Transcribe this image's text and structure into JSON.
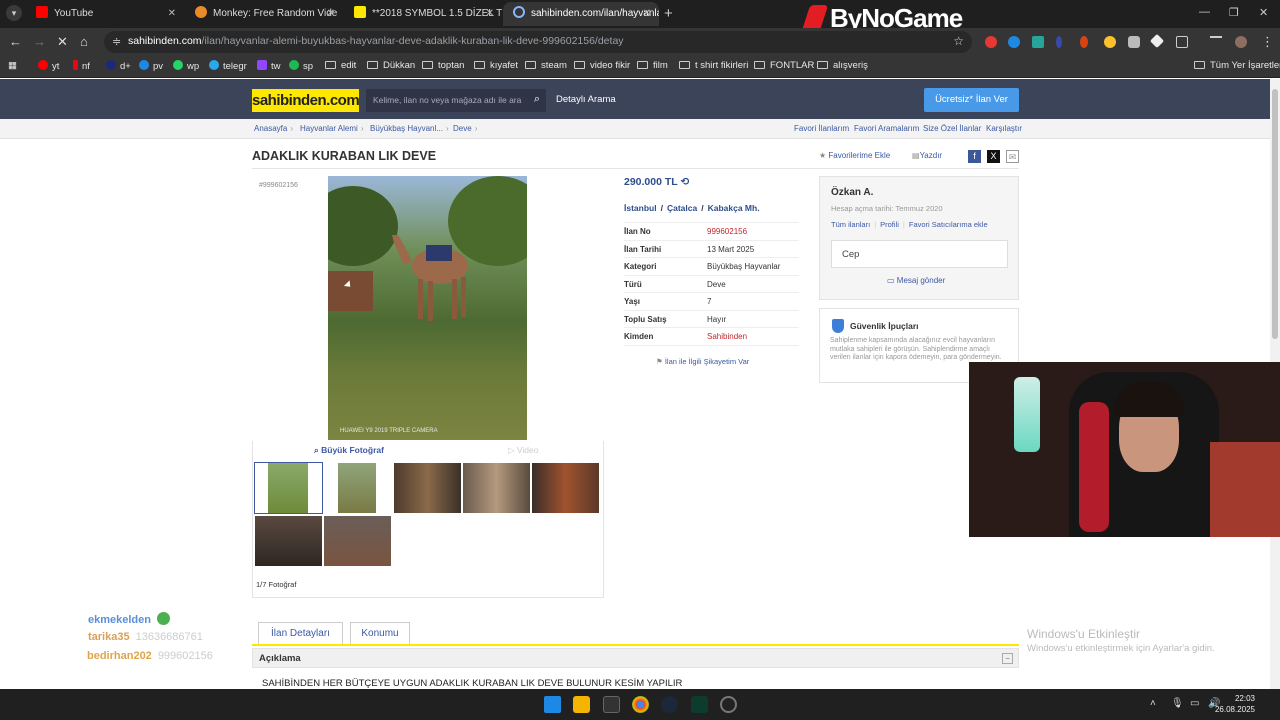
{
  "browser": {
    "tabs": [
      {
        "title": "YouTube",
        "color": "#ff0000"
      },
      {
        "title": "Monkey: Free Random Vide",
        "color": "#e98b2a"
      },
      {
        "title": "**2018 SYMBOL 1.5 DİZEL TRA",
        "color": "#ffe800"
      },
      {
        "title": "sahibinden.com/ilan/hayvanlar",
        "color": "#8ab4f8"
      }
    ],
    "new_tab": "+",
    "overlay_logo": "ByNoGame",
    "url_host": "sahibinden.com",
    "url_path": "/ilan/hayvanlar-alemi-buyukbas-hayvanlar-deve-adaklik-kuraban-lik-deve-999602156/detay",
    "bookmarks": [
      "yt",
      "nf",
      "d+",
      "pv",
      "wp",
      "telegr",
      "tw",
      "sp",
      "edit",
      "Dükkan",
      "toptan",
      "kıyafet",
      "steam",
      "video fikir",
      "film",
      "t shirt fikirleri",
      "FONTLAR",
      "alışveriş"
    ],
    "all_bookmarks": "Tüm Yer İşaretleri"
  },
  "site": {
    "logo": "sahibinden.com",
    "search_placeholder": "Kelime, ilan no veya mağaza adı ile ara",
    "detailed_search": "Detaylı Arama",
    "post_ad": "Ücretsiz* İlan Ver",
    "breadcrumbs": [
      "Anasayfa",
      "Hayvanlar Alemi",
      "Büyükbaş Hayvanl...",
      "Deve"
    ],
    "top_links": [
      "Favori İlanlarım",
      "Favori Aramalarım",
      "Size Özel İlanlar",
      "Karşılaştır"
    ]
  },
  "listing": {
    "title": "ADAKLIK KURABAN LIK DEVE",
    "add_favorite": "Favorilerime Ekle",
    "print": "Yazdır",
    "ad_no_tag": "#999602156",
    "photo_watermark": "HUAWEI Y9 2019 TRIPLE CAMERA",
    "big_photo": "Büyük Fotoğraf",
    "video": "Video",
    "photo_count": "1/7 Fotoğraf",
    "price": "290.000 TL",
    "location": [
      "İstanbul",
      "Çatalca",
      "Kabakça Mh."
    ],
    "info": [
      {
        "k": "İlan No",
        "v": "999602156",
        "red": true
      },
      {
        "k": "İlan Tarihi",
        "v": "13 Mart 2025",
        "red": false
      },
      {
        "k": "Kategori",
        "v": "Büyükbaş Hayvanlar",
        "red": false
      },
      {
        "k": "Türü",
        "v": "Deve",
        "red": false
      },
      {
        "k": "Yaşı",
        "v": "7",
        "red": false
      },
      {
        "k": "Toplu Satış",
        "v": "Hayır",
        "red": false
      },
      {
        "k": "Kimden",
        "v": "Sahibinden",
        "red": true
      }
    ],
    "complaint": "İlan ile İlgili Şikayetim Var",
    "tabs": [
      "İlan Detayları",
      "Konumu"
    ],
    "section_title": "Açıklama",
    "description": "SAHİBİNDEN HER BÜTÇEYE UYGUN ADAKLIK KURABAN LIK DEVE BULUNUR KESİM YAPILIR"
  },
  "seller": {
    "name": "Özkan A.",
    "since": "Hesap açma tarihi: Temmuz 2020",
    "links": [
      "Tüm ilanları",
      "Profili",
      "Favori Satıcılarıma ekle"
    ],
    "phone_label": "Cep",
    "message": "Mesaj gönder"
  },
  "security": {
    "title": "Güvenlik İpuçları",
    "text": "Sahiplenme kapsamında alacağınız evcil hayvanların mutlaka sahipleri ile görüşün. Sahiplendirme amaçlı verilen ilanlar için kapora ödemeyin, para göndermeyin."
  },
  "overlay": {
    "chat": [
      {
        "user": "ekmekelden",
        "msg": "",
        "color": "#5b8fd8"
      },
      {
        "user": "tarika35",
        "msg": "13636686761",
        "color": "#d8a15b"
      },
      {
        "user": "bedirhan202",
        "msg": "999602156",
        "color": "#e0a54a"
      }
    ],
    "windows_activate_title": "Windows'u Etkinleştir",
    "windows_activate_sub": "Windows'u etkinleştirmek için Ayarlar'a gidin."
  },
  "system": {
    "time": "22:03",
    "date": "26.08.2025"
  }
}
